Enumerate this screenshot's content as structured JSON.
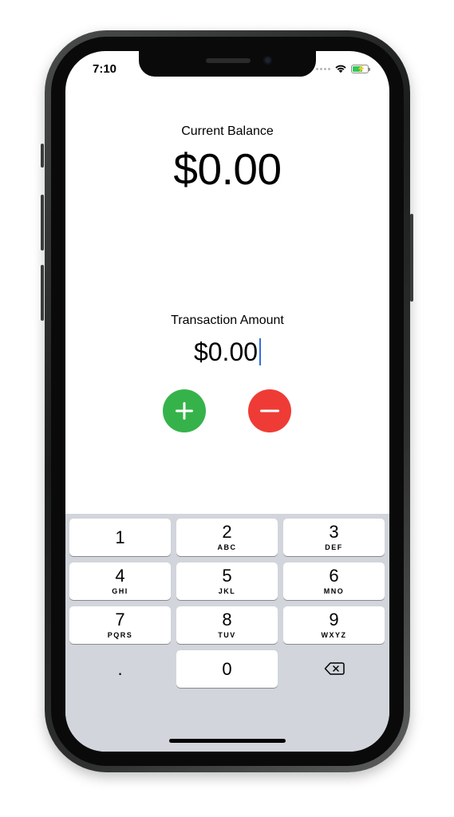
{
  "status_bar": {
    "time": "7:10",
    "icons": [
      "cellular-signal-icon",
      "wifi-icon",
      "battery-charging-icon"
    ],
    "battery_color": "#34c759"
  },
  "main": {
    "balance_label": "Current Balance",
    "balance_value": "$0.00",
    "transaction_label": "Transaction Amount",
    "transaction_value": "$0.00",
    "add_button": {
      "icon": "plus-icon",
      "color": "#35b34a"
    },
    "subtract_button": {
      "icon": "minus-icon",
      "color": "#ef3b36"
    },
    "caret_color": "#2f6fe0"
  },
  "keypad": {
    "keys": [
      {
        "digit": "1",
        "letters": ""
      },
      {
        "digit": "2",
        "letters": "ABC"
      },
      {
        "digit": "3",
        "letters": "DEF"
      },
      {
        "digit": "4",
        "letters": "GHI"
      },
      {
        "digit": "5",
        "letters": "JKL"
      },
      {
        "digit": "6",
        "letters": "MNO"
      },
      {
        "digit": "7",
        "letters": "PQRS"
      },
      {
        "digit": "8",
        "letters": "TUV"
      },
      {
        "digit": "9",
        "letters": "WXYZ"
      },
      {
        "digit": ".",
        "letters": ""
      },
      {
        "digit": "0",
        "letters": ""
      },
      {
        "digit": "",
        "letters": "",
        "icon": "backspace-icon"
      }
    ],
    "background": "#d2d5db"
  }
}
